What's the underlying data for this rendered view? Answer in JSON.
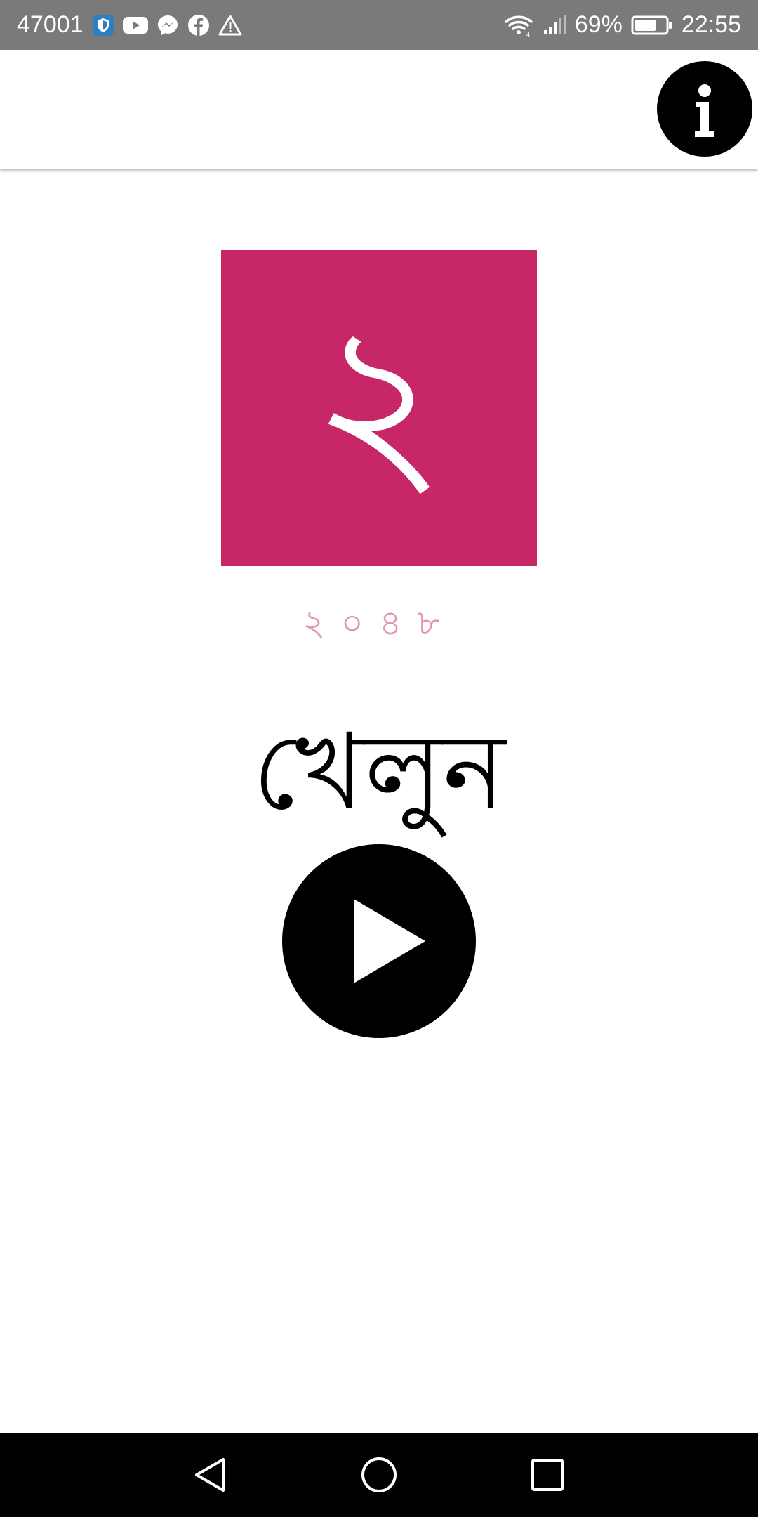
{
  "status_bar": {
    "notification_count": "47001",
    "battery_percent": "69%",
    "time": "22:55",
    "left_icons": [
      "shield-icon",
      "youtube-icon",
      "messenger-icon",
      "facebook-icon",
      "warning-icon"
    ],
    "right_icons": [
      "wifi-icon",
      "signal-icon",
      "battery-icon"
    ],
    "battery_level": 0.69
  },
  "app_bar": {
    "info_icon": "info-icon"
  },
  "game": {
    "tile_value": "২",
    "tile_color": "#c72766",
    "score": "২০৪৮",
    "score_color": "#e495b4",
    "play_label": "খেলুন",
    "play_icon": "play-icon"
  },
  "nav_bar": {
    "buttons": [
      "back-icon",
      "home-icon",
      "recents-icon"
    ]
  }
}
